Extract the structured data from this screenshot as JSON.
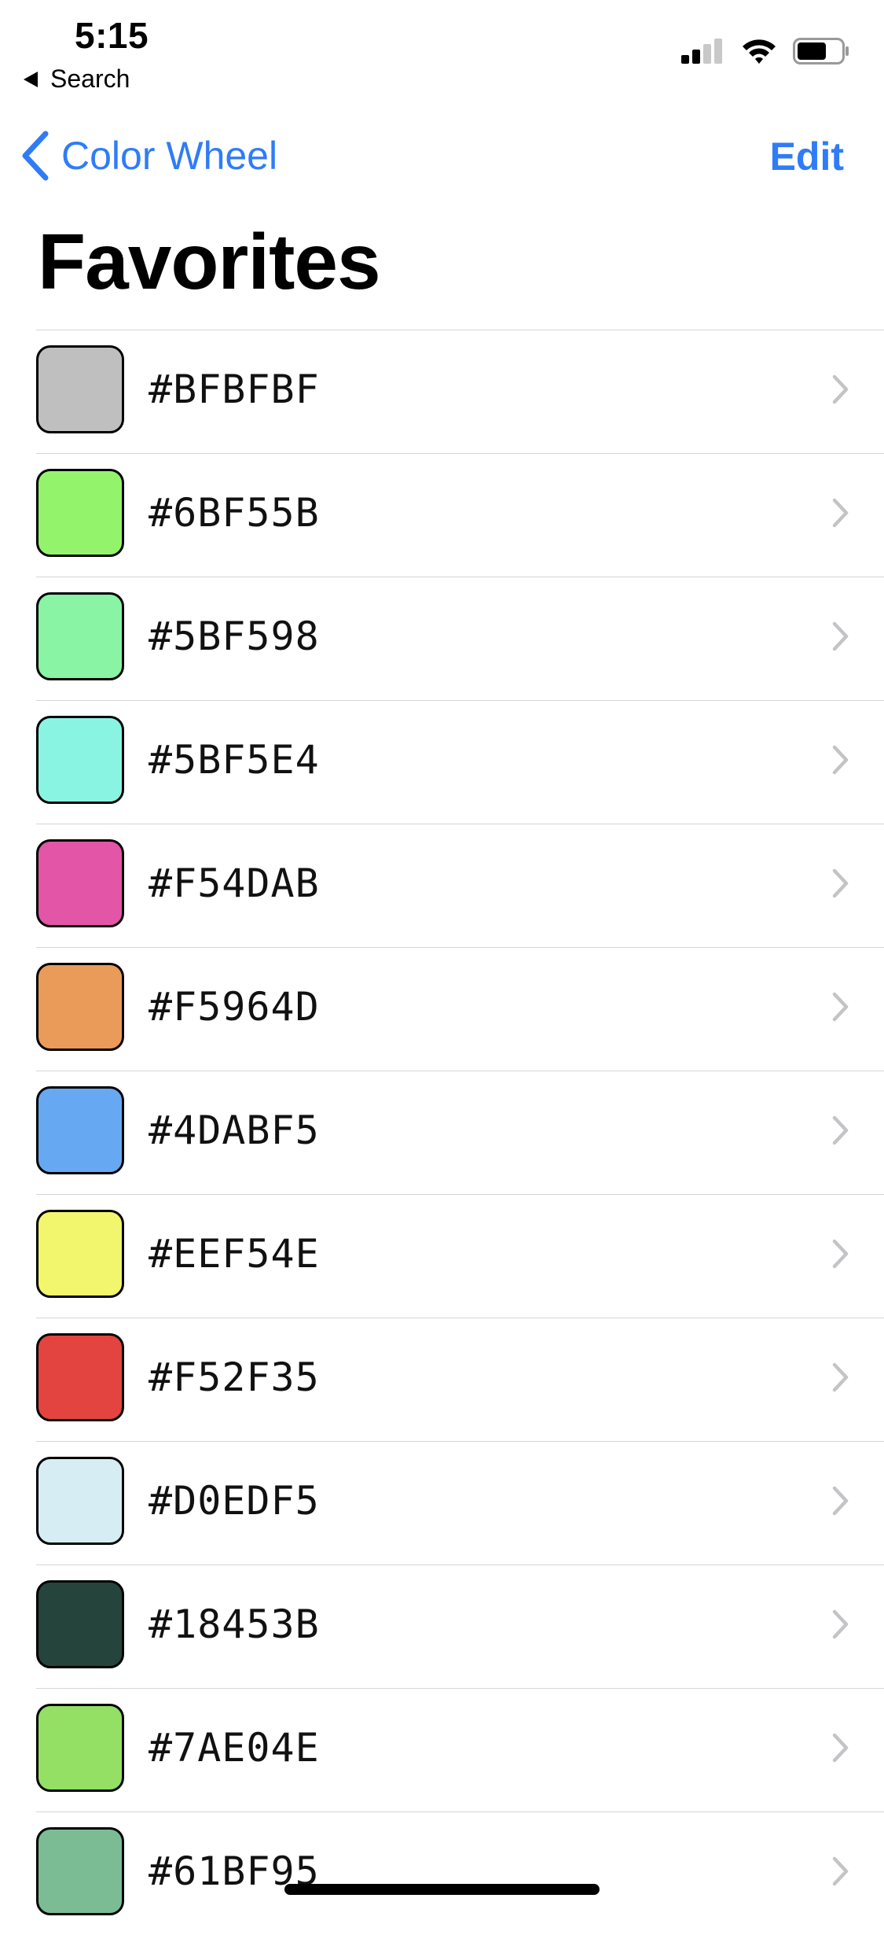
{
  "status_bar": {
    "time": "5:15",
    "back_app_label": "Search"
  },
  "nav": {
    "back_label": "Color Wheel",
    "edit_label": "Edit"
  },
  "page": {
    "title": "Favorites"
  },
  "accent_color": "#2f7cf6",
  "favorites": [
    {
      "hex": "#BFBFBF",
      "swatch": "#BFBFBF"
    },
    {
      "hex": "#6BF55B",
      "swatch": "#93F46C"
    },
    {
      "hex": "#5BF598",
      "swatch": "#88F4A4"
    },
    {
      "hex": "#5BF5E4",
      "swatch": "#8AF4E2"
    },
    {
      "hex": "#F54DAB",
      "swatch": "#E255A7"
    },
    {
      "hex": "#F5964D",
      "swatch": "#EA9B5A"
    },
    {
      "hex": "#4DABF5",
      "swatch": "#66A9F2"
    },
    {
      "hex": "#EEF54E",
      "swatch": "#F2F66C"
    },
    {
      "hex": "#F52F35",
      "swatch": "#E34440"
    },
    {
      "hex": "#D0EDF5",
      "swatch": "#D6EDF3"
    },
    {
      "hex": "#18453B",
      "swatch": "#25443B"
    },
    {
      "hex": "#7AE04E",
      "swatch": "#93E065"
    },
    {
      "hex": "#61BF95",
      "swatch": "#7BBC95"
    }
  ]
}
